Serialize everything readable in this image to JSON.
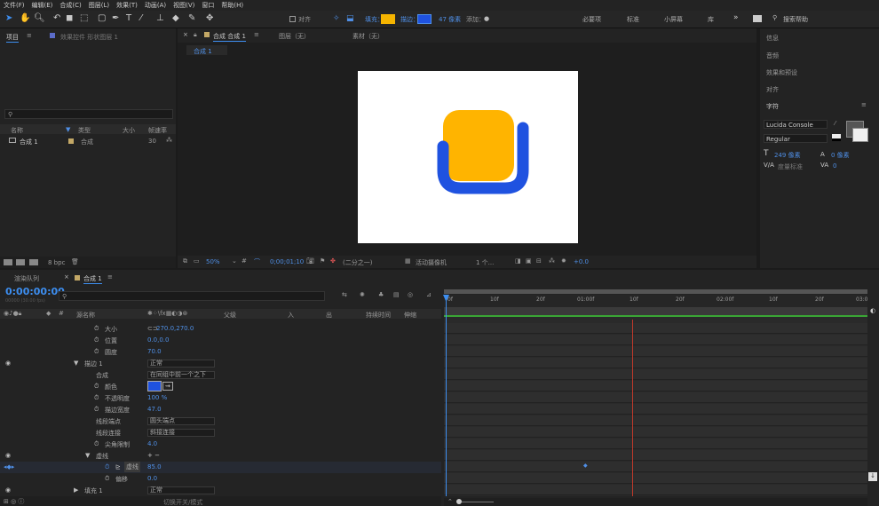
{
  "menu": [
    "文件(F)",
    "编辑(E)",
    "合成(C)",
    "图层(L)",
    "效果(T)",
    "动画(A)",
    "视图(V)",
    "窗口",
    "帮助(H)"
  ],
  "toolbar": {
    "align": "对齐",
    "fill": "填充：",
    "stroke": "描边：",
    "stroke_px": "47 像素",
    "add": "添加：",
    "workspaces": [
      "必要项",
      "标准",
      "小屏幕",
      "库"
    ],
    "search_placeholder": "搜索帮助"
  },
  "project": {
    "tab": "项目",
    "effects_tab": "效果控件 形状图层 1",
    "col_name": "名称",
    "col_type": "类型",
    "col_size": "大小",
    "col_fps": "帧速率",
    "item_name": "合成 1",
    "item_type": "合成",
    "item_fps": "30",
    "bpc": "8 bpc"
  },
  "comp": {
    "tab": "合成 合成 1",
    "layer_tab": "图层（无）",
    "footage_tab": "素材（无）",
    "subtab": "合成 1",
    "zoom": "50%",
    "timecode": "0;00;01;10",
    "resolution": "(二分之一)",
    "camera": "活动摄像机",
    "view": "1 个...",
    "exposure": "+0.0"
  },
  "right": {
    "items": [
      "信息",
      "音频",
      "效果和预设",
      "对齐",
      "字符"
    ],
    "font": "Lucida Console",
    "style": "Regular",
    "size": "249 像素",
    "tracking": "0 像素",
    "metric": "度量标准",
    "va": "0"
  },
  "timeline": {
    "render_tab": "渲染队列",
    "comp_tab": "合成 1",
    "time": "0:00:00:00",
    "fps_note": "00000 (30.00 fps)",
    "col_layer": "源名称",
    "col_parent": "父级",
    "col_in": "入",
    "col_out": "出",
    "col_dur": "持续时间",
    "col_stretch": "伸缩",
    "footer": "切换开关/模式",
    "ruler": [
      "0f",
      "10f",
      "20f",
      "01:00f",
      "10f",
      "20f",
      "02:00f",
      "10f",
      "20f",
      "03:0"
    ],
    "rows": [
      {
        "label": "大小",
        "value": "270.0,270.0"
      },
      {
        "label": "位置",
        "value": "0.0,0.0"
      },
      {
        "label": "圆度",
        "value": "70.0"
      },
      {
        "label": "描边 1",
        "value": "正常"
      },
      {
        "label": "合成",
        "value": "在同组中前一个之下"
      },
      {
        "label": "颜色",
        "value": ""
      },
      {
        "label": "不透明度",
        "value": "100 %"
      },
      {
        "label": "描边宽度",
        "value": "47.0"
      },
      {
        "label": "线段端点",
        "value": "圆头端点"
      },
      {
        "label": "线段连接",
        "value": "斜接连接"
      },
      {
        "label": "尖角限制",
        "value": "4.0"
      },
      {
        "label": "虚线",
        "value": ""
      },
      {
        "label": "虚线",
        "value": "85.0"
      },
      {
        "label": "偏移",
        "value": "0.0"
      },
      {
        "label": "填充 1",
        "value": "正常"
      }
    ]
  },
  "colors": {
    "accent": "#2d8cf0",
    "fill": "#f5b400",
    "stroke": "#1f52e0",
    "shape_yellow": "#ffb400",
    "shape_blue": "#1f52e0"
  }
}
